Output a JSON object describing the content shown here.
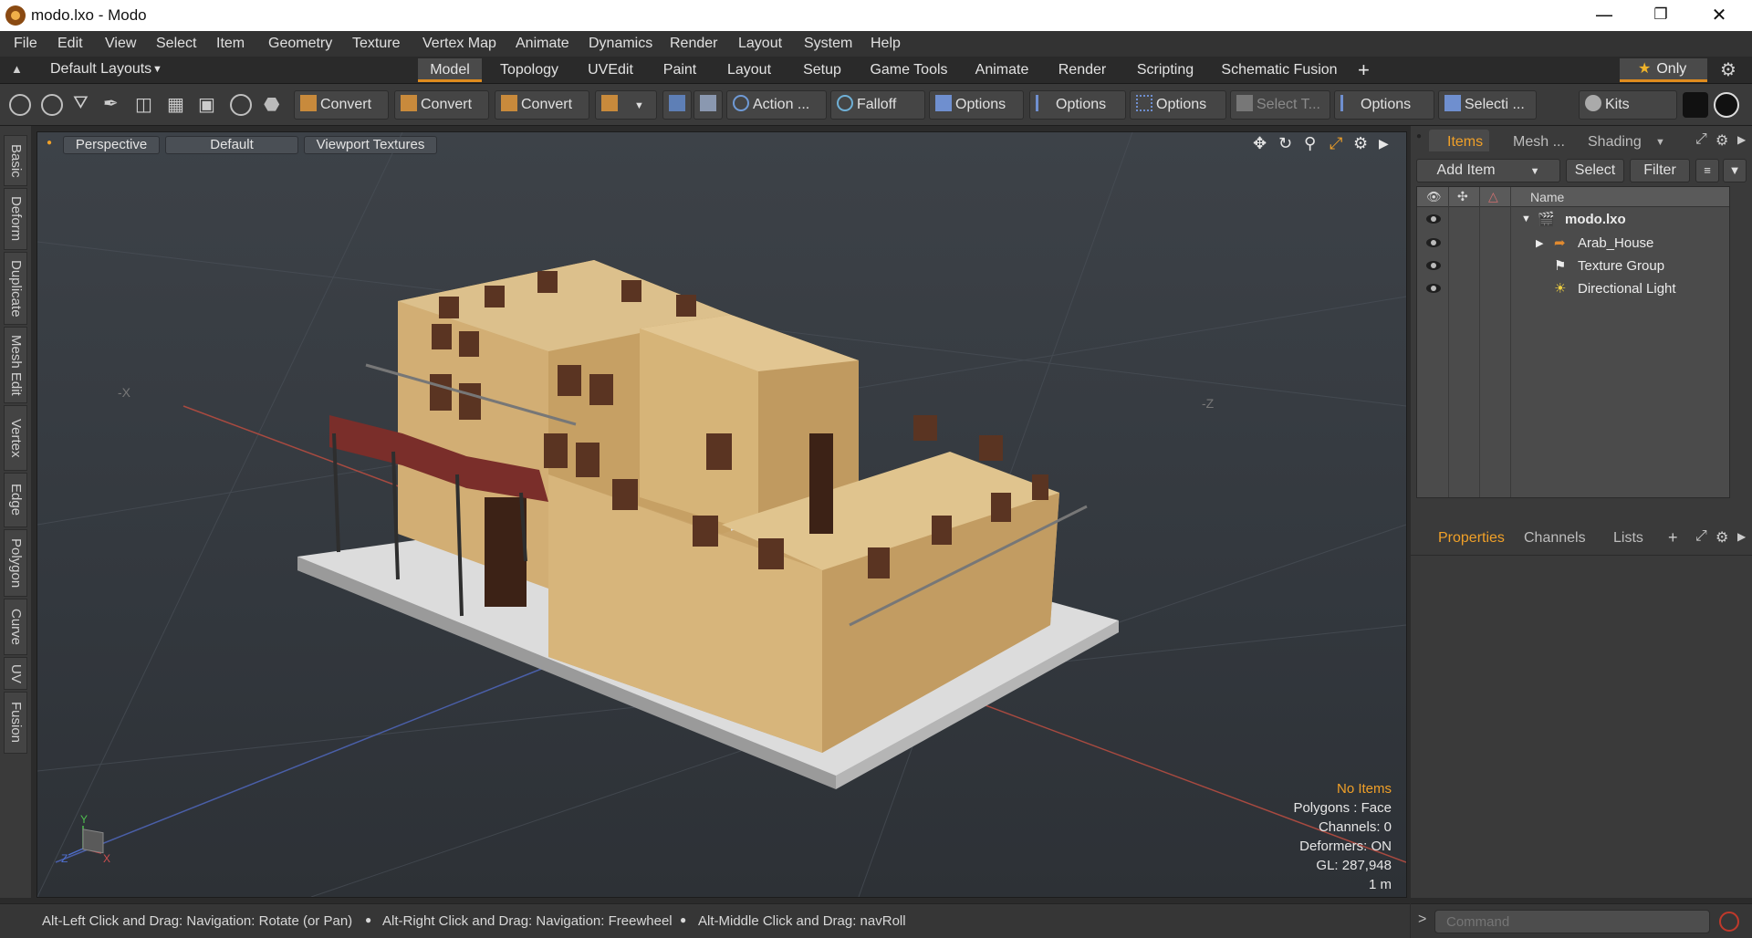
{
  "window": {
    "title": "modo.lxo - Modo",
    "minimize_icon": "minimize-icon",
    "maximize_icon": "restore-icon",
    "close_icon": "close-icon"
  },
  "menu": [
    "File",
    "Edit",
    "View",
    "Select",
    "Item",
    "Geometry",
    "Texture",
    "Vertex Map",
    "Animate",
    "Dynamics",
    "Render",
    "Layout",
    "System",
    "Help"
  ],
  "layout_bar": {
    "layout_dropdown": "Default Layouts",
    "tabs": [
      "Model",
      "Topology",
      "UVEdit",
      "Paint",
      "Layout",
      "Setup",
      "Game Tools",
      "Animate",
      "Render",
      "Scripting",
      "Schematic Fusion"
    ],
    "active_tab": "Model",
    "only_button": "Only"
  },
  "toolbar": {
    "convert_1": "Convert",
    "convert_2": "Convert",
    "convert_3": "Convert",
    "action": "Action  ...",
    "falloff": "Falloff",
    "options_1": "Options",
    "options_2": "Options",
    "options_3": "Options",
    "select_t": "Select T...",
    "options_4": "Options",
    "selecti": "Selecti ...",
    "kits": "Kits"
  },
  "left_tabs": [
    "Basic",
    "Deform",
    "Duplicate",
    "Mesh Edit",
    "Vertex",
    "Edge",
    "Polygon",
    "Curve",
    "UV",
    "Fusion"
  ],
  "viewport": {
    "view_mode": "Perspective",
    "style": "Default",
    "textures": "Viewport Textures",
    "axis_neg_x": "-X",
    "axis_neg_z": "-Z",
    "gizmo_y": "Y",
    "gizmo_z": "Z",
    "gizmo_x": "X",
    "hud": {
      "items": "No Items",
      "polygons": "Polygons : Face",
      "channels": "Channels: 0",
      "deformers": "Deformers: ON",
      "gl": "GL: 287,948",
      "scale": "1 m"
    }
  },
  "items_panel": {
    "tabs": [
      "Items",
      "Mesh ...",
      "Shading"
    ],
    "active_tab": "Items",
    "add_item": "Add Item",
    "select": "Select",
    "filter": "Filter",
    "column_name": "Name",
    "tree": [
      {
        "label": "modo.lxo",
        "level": 0
      },
      {
        "label": "Arab_House",
        "level": 1
      },
      {
        "label": "Texture Group",
        "level": 1
      },
      {
        "label": "Directional Light",
        "level": 1
      }
    ]
  },
  "properties_panel": {
    "tabs": [
      "Properties",
      "Channels",
      "Lists"
    ],
    "active_tab": "Properties"
  },
  "status": {
    "hint_1": "Alt-Left Click and Drag: Navigation: Rotate (or Pan)",
    "hint_2": "Alt-Right Click and Drag: Navigation: Freewheel",
    "hint_3": "Alt-Middle Click and Drag: navRoll",
    "command_placeholder": "Command"
  },
  "colors": {
    "accent": "#e08c1e",
    "wall": "#c9a46a",
    "ground": "#d6d6d6"
  }
}
